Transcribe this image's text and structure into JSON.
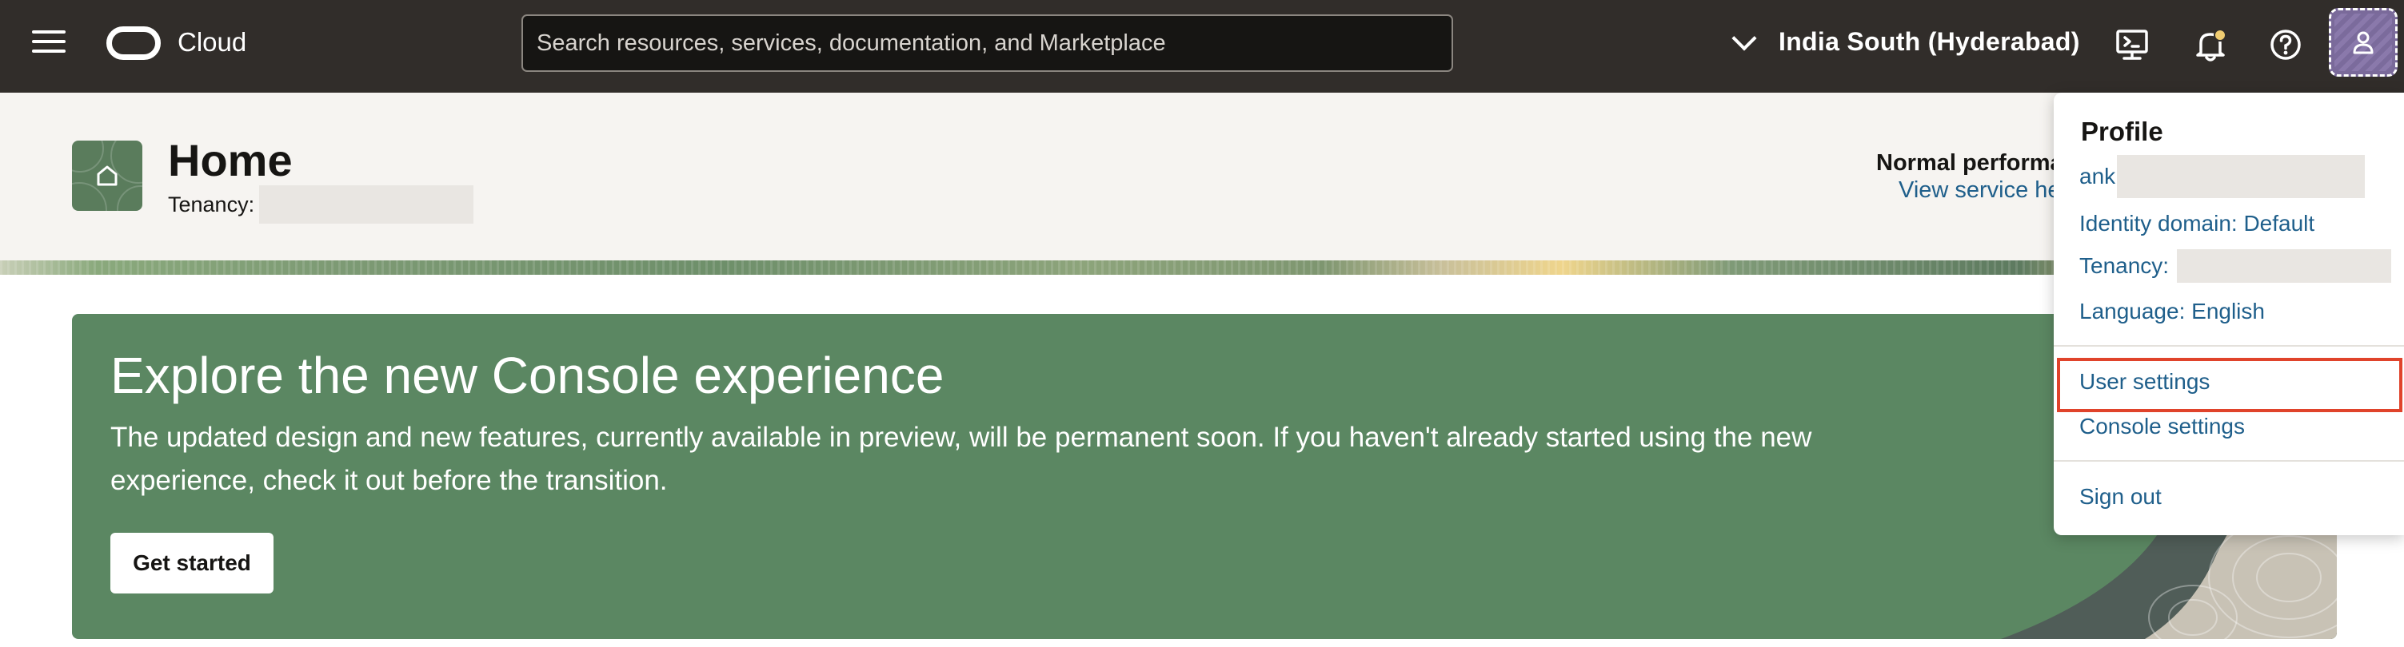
{
  "topbar": {
    "brand": "Cloud",
    "search_placeholder": "Search resources, services, documentation, and Marketplace",
    "region": "India South (Hyderabad)"
  },
  "home": {
    "title": "Home",
    "tenancy_label": "Tenancy:",
    "performance_text": "Normal performa",
    "service_link": "View service he"
  },
  "banner": {
    "title": "Explore the new Console experience",
    "description": "The updated design and new features, currently available in preview, will be permanent soon. If you haven't already started using the new experience, check it out before the transition.",
    "button_label": "Get started"
  },
  "profile_menu": {
    "heading": "Profile",
    "username_prefix": "ank",
    "identity_domain": "Identity domain: Default",
    "tenancy_label": "Tenancy:",
    "language": "Language: English",
    "user_settings": "User settings",
    "console_settings": "Console settings",
    "sign_out": "Sign out"
  },
  "colors": {
    "topbar_bg": "#312d2a",
    "banner_bg": "#5b8762",
    "link": "#1f5f8b",
    "highlight": "#e0432b"
  },
  "icons": [
    "menu-icon",
    "oracle-logo-icon",
    "chevron-down-icon",
    "cloud-shell-icon",
    "bell-icon",
    "help-icon",
    "user-icon",
    "home-icon"
  ]
}
